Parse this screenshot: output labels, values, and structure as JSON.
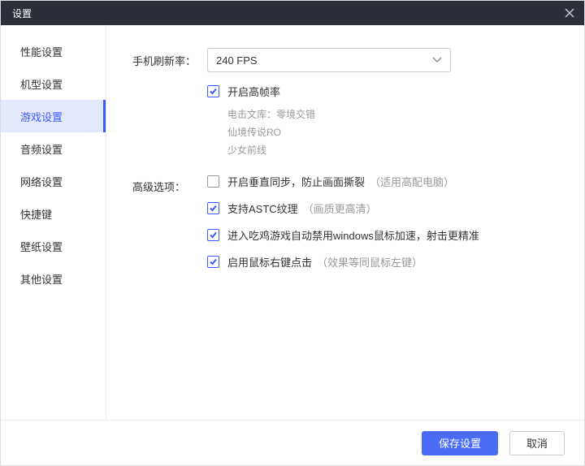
{
  "window": {
    "title": "设置"
  },
  "sidebar": {
    "items": [
      {
        "label": "性能设置"
      },
      {
        "label": "机型设置"
      },
      {
        "label": "游戏设置"
      },
      {
        "label": "音频设置"
      },
      {
        "label": "网络设置"
      },
      {
        "label": "快捷键"
      },
      {
        "label": "壁纸设置"
      },
      {
        "label": "其他设置"
      }
    ],
    "activeIndex": 2
  },
  "content": {
    "refresh": {
      "label": "手机刷新率：",
      "value": "240 FPS",
      "highfps": {
        "label": "开启高帧率",
        "games": [
          "电击文库：零境交错",
          "仙境传说RO",
          "少女前线"
        ]
      }
    },
    "advanced": {
      "label": "高级选项：",
      "vsync": {
        "label": "开启垂直同步，防止画面撕裂",
        "hint": "（适用高配电脑）"
      },
      "astc": {
        "label": "支持ASTC纹理",
        "hint": "（画质更高清）"
      },
      "mouse": {
        "label": "进入吃鸡游戏自动禁用windows鼠标加速，射击更精准"
      },
      "rclick": {
        "label": "启用鼠标右键点击",
        "hint": "（效果等同鼠标左键）"
      }
    }
  },
  "footer": {
    "save": "保存设置",
    "cancel": "取消"
  }
}
